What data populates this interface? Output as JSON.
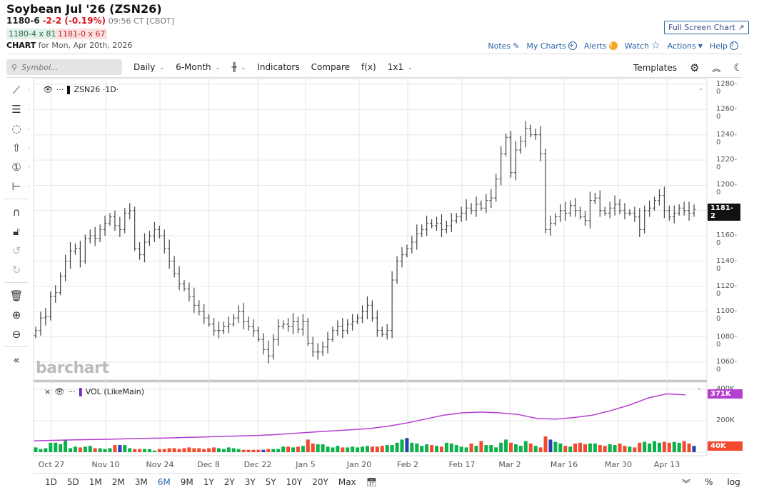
{
  "header": {
    "title": "Soybean Jul '26 (ZSN26)",
    "last": "1180-6",
    "change": "-2-2 (-0.19%)",
    "time": "09:56 CT [CBOT]",
    "bid": "1180-4 x 81",
    "ask": "1181-0 x 67",
    "chart_label": "CHART",
    "chart_for": "for Mon, Apr 20th, 2026",
    "full_screen": "Full Screen Chart"
  },
  "links": [
    {
      "label": "Notes",
      "icon": "edit-icon"
    },
    {
      "label": "My Charts",
      "icon": "plus-circle-icon"
    },
    {
      "label": "Alerts",
      "icon": "alert-icon"
    },
    {
      "label": "Watch",
      "icon": "star-icon"
    },
    {
      "label": "Actions",
      "icon": "caret-down-icon"
    },
    {
      "label": "Help",
      "icon": "help-icon"
    }
  ],
  "toolbar": {
    "search_placeholder": "Symbol...",
    "interval": "Daily",
    "range": "6-Month",
    "bar_type_icon": "ohlc-bar-icon",
    "indicators": "Indicators",
    "compare": "Compare",
    "fx": "f(x)",
    "layout": "1x1",
    "templates": "Templates"
  },
  "left_tools": [
    "trendline-icon",
    "fib-icon",
    "shape-icon",
    "arrow-up-icon",
    "numbered-marker-icon",
    "measure-icon",
    "magnet-icon",
    "unlock-icon",
    "undo-icon",
    "redo-icon",
    "trash-icon",
    "zoom-in-icon",
    "zoom-out-icon",
    "collapse-icon"
  ],
  "price_pane": {
    "legend": "ZSN26 ·1D·",
    "watermark": "barchart",
    "last_price_label": "1181-2"
  },
  "volume_pane": {
    "legend": "VOL (LikeMain)",
    "max_label": "371K",
    "last_label": "40K",
    "axis_labels": [
      "400K",
      "200K",
      "0K"
    ]
  },
  "periods": [
    "1D",
    "5D",
    "1M",
    "2M",
    "3M",
    "6M",
    "9M",
    "1Y",
    "2Y",
    "3Y",
    "5Y",
    "10Y",
    "20Y",
    "Max"
  ],
  "active_period": "6M",
  "bottom_right": {
    "percent": "%",
    "log": "log"
  },
  "colors": {
    "up": "#0bb14b",
    "down": "#f2492f",
    "neutral": "#2a3fb0",
    "ma": "#b43fcf",
    "accent": "#2a64a8"
  },
  "chart_data": {
    "type": "ohlc",
    "price_axis_labels": [
      "1280-0",
      "1260-0",
      "1240-0",
      "1220-0",
      "1200-0",
      "1180-0",
      "1160-0",
      "1140-0",
      "1120-0",
      "1100-0",
      "1080-0",
      "1060-0"
    ],
    "ylim": [
      1060,
      1280
    ],
    "x_tick_labels": [
      "Oct 27",
      "Nov 10",
      "Nov 24",
      "Dec 8",
      "Dec 22",
      "Jan 5",
      "Jan 20",
      "Feb 2",
      "Feb 17",
      "Mar 2",
      "Mar 16",
      "Mar 30",
      "Apr 13"
    ],
    "close": [
      1085,
      1095,
      1096,
      1112,
      1115,
      1128,
      1140,
      1148,
      1150,
      1140,
      1158,
      1160,
      1158,
      1165,
      1170,
      1175,
      1168,
      1165,
      1178,
      1180,
      1150,
      1145,
      1155,
      1160,
      1165,
      1160,
      1150,
      1140,
      1130,
      1122,
      1118,
      1112,
      1105,
      1100,
      1095,
      1090,
      1085,
      1085,
      1088,
      1090,
      1095,
      1100,
      1092,
      1088,
      1085,
      1078,
      1070,
      1065,
      1078,
      1088,
      1090,
      1088,
      1092,
      1086,
      1092,
      1075,
      1068,
      1068,
      1072,
      1078,
      1085,
      1088,
      1085,
      1090,
      1092,
      1095,
      1100,
      1105,
      1095,
      1085,
      1082,
      1085,
      1125,
      1140,
      1145,
      1150,
      1155,
      1162,
      1165,
      1170,
      1168,
      1170,
      1165,
      1168,
      1172,
      1175,
      1178,
      1182,
      1180,
      1185,
      1182,
      1188,
      1190,
      1205,
      1225,
      1238,
      1210,
      1228,
      1235,
      1245,
      1240,
      1240,
      1225,
      1165,
      1170,
      1175,
      1180,
      1178,
      1184,
      1180,
      1175,
      1172,
      1188,
      1190,
      1180,
      1178,
      1182,
      1185,
      1180,
      1178,
      1178,
      1175,
      1165,
      1180,
      1182,
      1188,
      1192,
      1180,
      1175,
      1178,
      1182,
      1180,
      1178,
      1181
    ],
    "volume_k": [
      30,
      20,
      25,
      60,
      60,
      50,
      80,
      25,
      35,
      30,
      35,
      40,
      25,
      25,
      20,
      25,
      45,
      45,
      45,
      25,
      20,
      20,
      20,
      20,
      10,
      20,
      20,
      25,
      25,
      20,
      25,
      30,
      25,
      25,
      20,
      25,
      30,
      25,
      20,
      30,
      25,
      20,
      15,
      15,
      15,
      15,
      15,
      20,
      20,
      20,
      35,
      35,
      30,
      35,
      40,
      80,
      55,
      50,
      50,
      35,
      30,
      40,
      30,
      30,
      35,
      30,
      35,
      40,
      35,
      35,
      40,
      45,
      45,
      60,
      80,
      90,
      60,
      55,
      40,
      50,
      45,
      40,
      35,
      60,
      55,
      45,
      35,
      30,
      55,
      40,
      70,
      45,
      45,
      30,
      60,
      80,
      60,
      50,
      40,
      70,
      55,
      40,
      30,
      100,
      80,
      65,
      55,
      40,
      35,
      55,
      60,
      50,
      55,
      55,
      45,
      40,
      50,
      45,
      55,
      40,
      35,
      30,
      60,
      65,
      55,
      70,
      60,
      65,
      60,
      65,
      60,
      70,
      55,
      40
    ],
    "volume_ma_k": [
      72,
      75,
      78,
      80,
      82,
      85,
      88,
      90,
      93,
      96,
      100,
      103,
      106,
      112,
      120,
      128,
      135,
      142,
      150,
      165,
      185,
      210,
      235,
      250,
      255,
      250,
      240,
      215,
      210,
      220,
      235,
      265,
      300,
      345,
      371,
      365
    ]
  }
}
